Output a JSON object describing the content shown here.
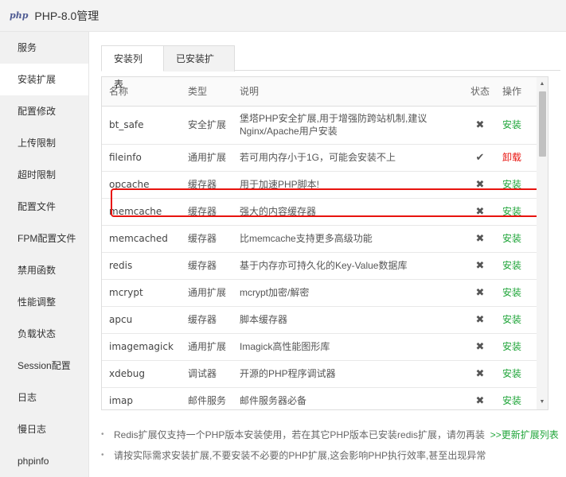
{
  "window": {
    "logo": "php",
    "title": "PHP-8.0管理"
  },
  "sidebar": {
    "items": [
      {
        "label": "服务"
      },
      {
        "label": "安装扩展"
      },
      {
        "label": "配置修改"
      },
      {
        "label": "上传限制"
      },
      {
        "label": "超时限制"
      },
      {
        "label": "配置文件"
      },
      {
        "label": "FPM配置文件"
      },
      {
        "label": "禁用函数"
      },
      {
        "label": "性能调整"
      },
      {
        "label": "负载状态"
      },
      {
        "label": "Session配置"
      },
      {
        "label": "日志"
      },
      {
        "label": "慢日志"
      },
      {
        "label": "phpinfo"
      }
    ],
    "active": "安装扩展"
  },
  "tabs": [
    {
      "label": "安装列表"
    },
    {
      "label": "已安装扩展"
    }
  ],
  "table": {
    "headers": {
      "name": "名称",
      "type": "类型",
      "desc": "说明",
      "status": "状态",
      "op": "操作"
    },
    "rows": [
      {
        "name": "bt_safe",
        "type": "安全扩展",
        "desc": "堡塔PHP安全扩展,用于增强防跨站机制,建议Nginx/Apache用户安装",
        "status": "✖",
        "op": "安装"
      },
      {
        "name": "fileinfo",
        "type": "通用扩展",
        "desc": "若可用内存小于1G，可能会安装不上",
        "status": "✔",
        "op": "卸载"
      },
      {
        "name": "opcache",
        "type": "缓存器",
        "desc": "用于加速PHP脚本!",
        "status": "✖",
        "op": "安装"
      },
      {
        "name": "memcache",
        "type": "缓存器",
        "desc": "强大的内容缓存器",
        "status": "✖",
        "op": "安装"
      },
      {
        "name": "memcached",
        "type": "缓存器",
        "desc": "比memcache支持更多高级功能",
        "status": "✖",
        "op": "安装"
      },
      {
        "name": "redis",
        "type": "缓存器",
        "desc": "基于内存亦可持久化的Key-Value数据库",
        "status": "✖",
        "op": "安装"
      },
      {
        "name": "mcrypt",
        "type": "通用扩展",
        "desc": "mcrypt加密/解密",
        "status": "✖",
        "op": "安装"
      },
      {
        "name": "apcu",
        "type": "缓存器",
        "desc": "脚本缓存器",
        "status": "✖",
        "op": "安装"
      },
      {
        "name": "imagemagick",
        "type": "通用扩展",
        "desc": "Imagick高性能图形库",
        "status": "✖",
        "op": "安装"
      },
      {
        "name": "xdebug",
        "type": "调试器",
        "desc": "开源的PHP程序调试器",
        "status": "✖",
        "op": "安装"
      },
      {
        "name": "imap",
        "type": "邮件服务",
        "desc": "邮件服务器必备",
        "status": "✖",
        "op": "安装"
      }
    ]
  },
  "scrollbar": {
    "up": "▲",
    "down": "▼"
  },
  "notes": {
    "bullet": "•",
    "note1": "Redis扩展仅支持一个PHP版本安装使用，若在其它PHP版本已安装redis扩展，请勿再装",
    "note1_link": ">>更新扩展列表",
    "note2": "请按实际需求安装扩展,不要安装不必要的PHP扩展,这会影响PHP执行效率,甚至出现异常"
  },
  "colors": {
    "install": "#20a53a",
    "uninstall": "#e8130e",
    "highlight": "#e8130e"
  }
}
